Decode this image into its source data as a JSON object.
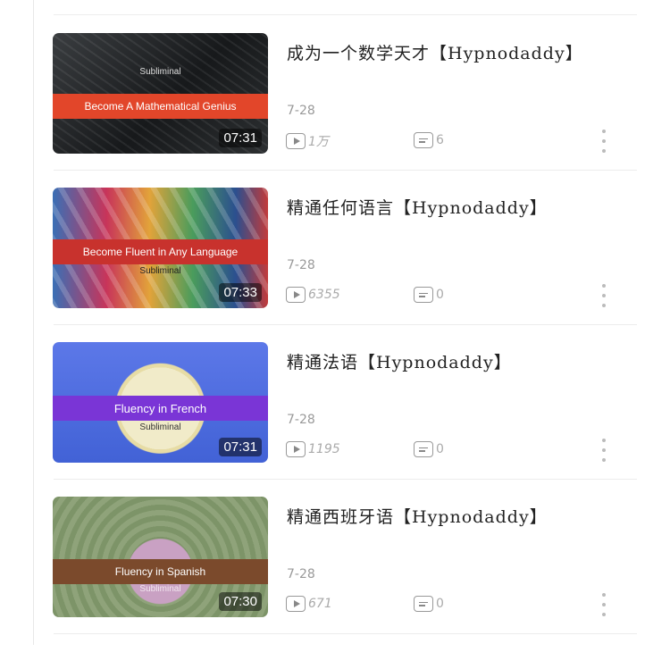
{
  "videos": [
    {
      "title": "成为一个数学天才【Hypnodaddy】",
      "date": "7-28",
      "plays": "1万",
      "comments": "6",
      "duration": "07:31",
      "thumb_heading": "Subliminal",
      "thumb_band": "Become A Mathematical Genius",
      "thumb_sub": "",
      "band_color": "#e2462a"
    },
    {
      "title": "精通任何语言【Hypnodaddy】",
      "date": "7-28",
      "plays": "6355",
      "comments": "0",
      "duration": "07:33",
      "thumb_heading": "",
      "thumb_band": "Become Fluent in Any Language",
      "thumb_sub": "Subliminal",
      "band_color": "#c8322d"
    },
    {
      "title": "精通法语【Hypnodaddy】",
      "date": "7-28",
      "plays": "1195",
      "comments": "0",
      "duration": "07:31",
      "thumb_heading": "",
      "thumb_band": "Fluency in French",
      "thumb_sub": "Subliminal",
      "band_color": "#7a35d6"
    },
    {
      "title": "精通西班牙语【Hypnodaddy】",
      "date": "7-28",
      "plays": "671",
      "comments": "0",
      "duration": "07:30",
      "thumb_heading": "",
      "thumb_band": "Fluency in Spanish",
      "thumb_sub": "Subliminal",
      "band_color": "#7b4a2c"
    }
  ],
  "icons": {
    "plays": "play-count-icon",
    "comments": "comment-count-icon",
    "more": "more-vertical-icon"
  }
}
